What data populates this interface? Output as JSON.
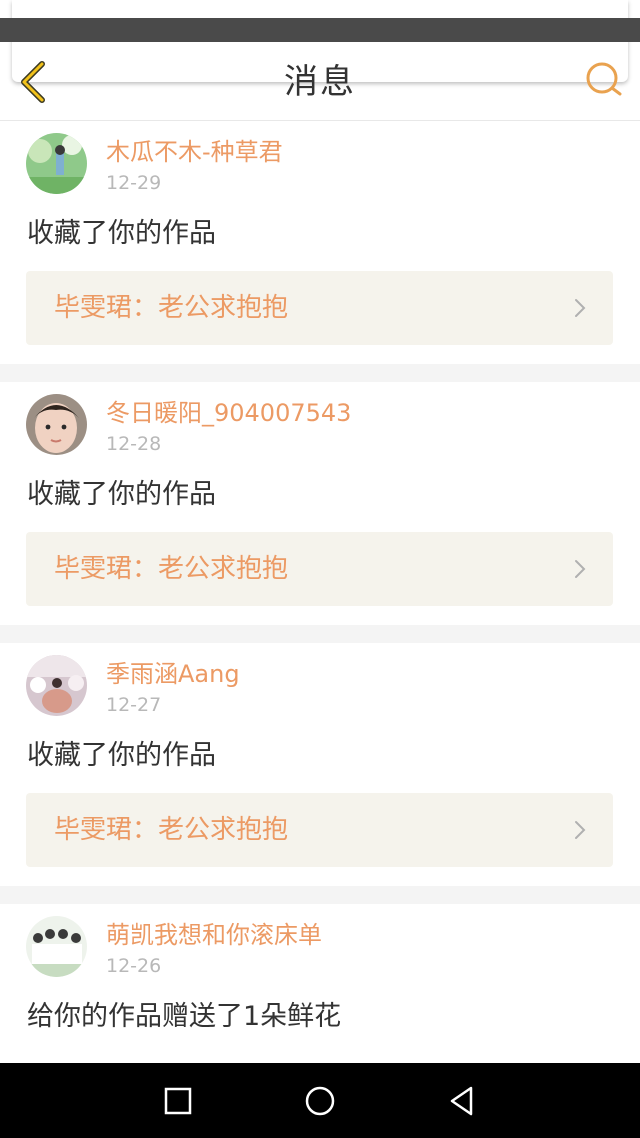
{
  "header": {
    "title": "消息",
    "back_icon": "chevron-left-icon",
    "search_icon": "search-icon",
    "accent_color": "#e9a24f"
  },
  "messages": [
    {
      "username": "木瓜不木-种草君",
      "date": "12-29",
      "action": "收藏了你的作品",
      "work": "毕雯珺：老公求抱抱"
    },
    {
      "username": "冬日暖阳_904007543",
      "date": "12-28",
      "action": "收藏了你的作品",
      "work": "毕雯珺：老公求抱抱"
    },
    {
      "username": "季雨涵Aang",
      "date": "12-27",
      "action": "收藏了你的作品",
      "work": "毕雯珺：老公求抱抱"
    },
    {
      "username": "萌凯我想和你滚床单",
      "date": "12-26",
      "action": "给你的作品赠送了1朵鲜花"
    }
  ],
  "navbar": {
    "icons": [
      "recent-apps-icon",
      "home-icon",
      "back-triangle-icon"
    ]
  },
  "colors": {
    "username": "#ec9a64",
    "work_text": "#ec9a64",
    "work_bg": "#f5f3ec",
    "date": "#b8b8b8"
  }
}
